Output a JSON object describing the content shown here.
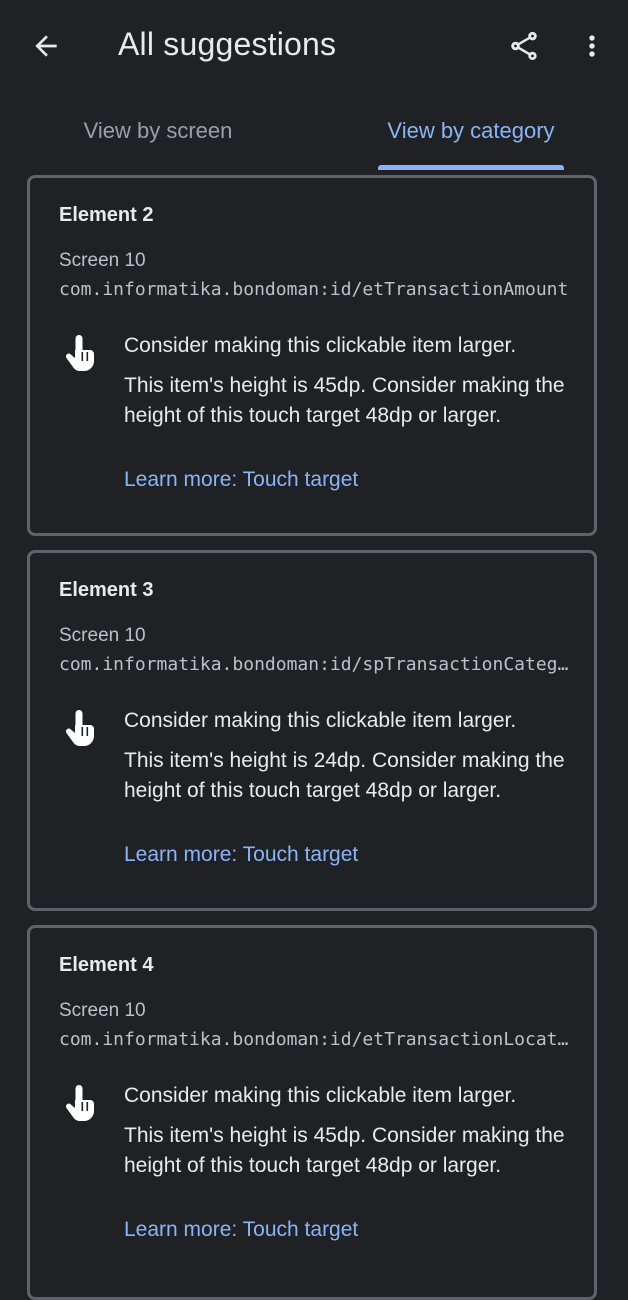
{
  "header": {
    "title": "All suggestions",
    "back_icon": "arrow-back-icon",
    "share_icon": "share-icon",
    "more_icon": "more-vert-icon"
  },
  "tabs": [
    {
      "label": "View by screen",
      "selected": false
    },
    {
      "label": "View by category",
      "selected": true
    }
  ],
  "colors": {
    "background": "#202124",
    "accent": "#8ab4f8",
    "card_border": "#5f6368",
    "text_primary": "#e8eaed",
    "text_secondary": "#bdc1c6",
    "tab_inactive": "#9aa0a6"
  },
  "cards": [
    {
      "title": "Element 2",
      "screen": "Screen 10",
      "resource_id": "com.informatika.bondoman:id/etTransactionAmount",
      "icon": "touch-target-icon",
      "issue_title": "Consider making this clickable item larger.",
      "issue_desc": "This item's height is 45dp. Consider making the height of this touch target 48dp or larger.",
      "link": "Learn more: Touch target"
    },
    {
      "title": "Element 3",
      "screen": "Screen 10",
      "resource_id": "com.informatika.bondoman:id/spTransactionCategory",
      "icon": "touch-target-icon",
      "issue_title": "Consider making this clickable item larger.",
      "issue_desc": "This item's height is 24dp. Consider making the height of this touch target 48dp or larger.",
      "link": "Learn more: Touch target"
    },
    {
      "title": "Element 4",
      "screen": "Screen 10",
      "resource_id": "com.informatika.bondoman:id/etTransactionLocation",
      "icon": "touch-target-icon",
      "issue_title": "Consider making this clickable item larger.",
      "issue_desc": "This item's height is 45dp. Consider making the height of this touch target 48dp or larger.",
      "link": "Learn more: Touch target"
    }
  ]
}
